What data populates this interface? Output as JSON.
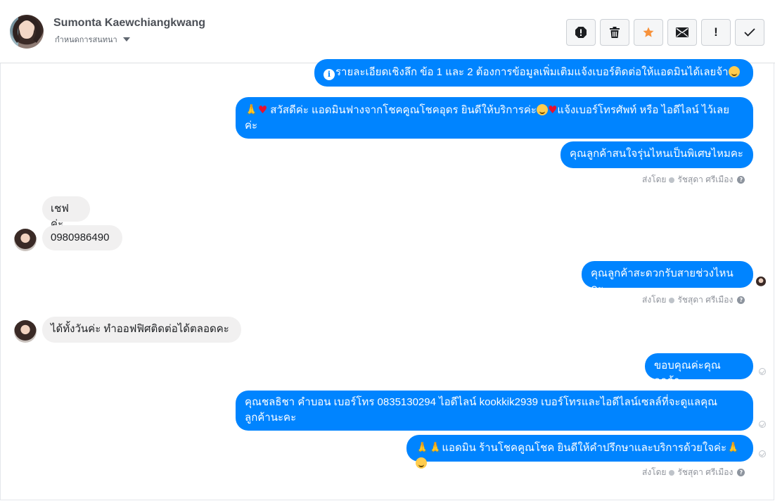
{
  "header": {
    "contact_name": "Sumonta Kaewchiangkwang",
    "assign_label": "กำหนดการสนทนา",
    "toolbar": [
      {
        "name": "mark-spam-button",
        "icon": "alert-circle-icon"
      },
      {
        "name": "delete-button",
        "icon": "trash-icon"
      },
      {
        "name": "star-button",
        "icon": "star-icon"
      },
      {
        "name": "mark-unread-button",
        "icon": "envelope-icon"
      },
      {
        "name": "follow-up-button",
        "icon": "exclamation-icon",
        "glyph": "!"
      },
      {
        "name": "mark-done-button",
        "icon": "checkmark-icon"
      }
    ],
    "star_color": "#f7923b"
  },
  "messages": {
    "m1": "รายละเอียดเชิงลึก ข้อ 1 และ 2 ต้องการข้อมูลเพิ่มเติมแจ้งเบอร์ติดต่อให้แอดมินได้เลยจ้า",
    "m2_a": " สวัสดีค่ะ แอดมินฟางจากโชคคูณโชคอุดร ยินดีให้บริการค่ะ",
    "m2_b": "แจ้งเบอร์โทรศัพท์ หรือ ไอดีไลน์  ไว้เลย",
    "m2_c": "ค่ะ",
    "m3": "คุณลูกค้าสนใจรุ่นไหนเป็นพิเศษไหมคะ",
    "in1": "เชฟค่ะ",
    "in2": "0980986490",
    "m4": "คุณลูกค้าสะดวกรับสายช่วงไหนคะ",
    "in3": "ได้ทั้งวันค่ะ ทำออฟฟิศติดต่อได้ตลอดคะ",
    "m5": "ขอบคุณค่ะคุณลูกค้า",
    "m6_a": "คุณชลธิชา คำบอน เบอร์โทร 0835130294  ไอดีไลน์ kookkik2939   เบอร์โทรและไอดีไลน์เซลล์ที่จะดูแลคุณ",
    "m6_b": "ลูกค้านะคะ",
    "m7": "แอดมิน ร้านโชคคูณโชค ยินดีให้คำปรึกษาและบริการด้วยใจค่ะ"
  },
  "sent_by": {
    "prefix": "ส่งโดย",
    "agent": "รัชสุดา ศรีเมือง",
    "help": "?"
  },
  "colors": {
    "outgoing_bubble": "#0084ff",
    "incoming_bubble": "#f1f0f0"
  }
}
